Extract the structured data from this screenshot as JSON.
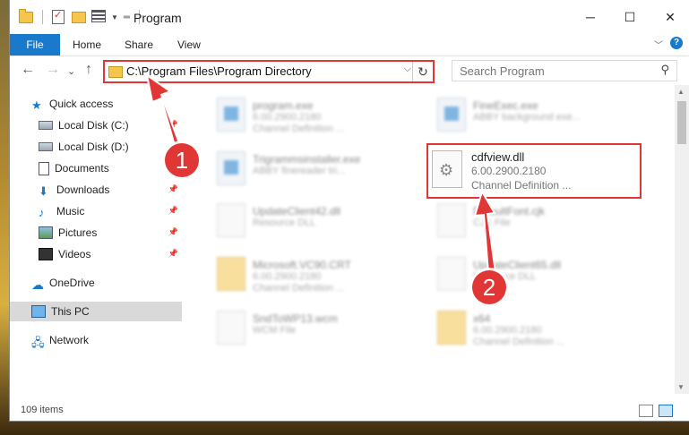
{
  "window": {
    "title": "Program",
    "controls": {
      "minimize": "─",
      "maximize": "☐",
      "close": "✕"
    }
  },
  "ribbon": {
    "tabs": [
      {
        "label": "File",
        "active": true
      },
      {
        "label": "Home"
      },
      {
        "label": "Share"
      },
      {
        "label": "View"
      }
    ],
    "help": "?"
  },
  "nav": {
    "back": "←",
    "forward": "→",
    "recent": "⌄",
    "up": "↑",
    "address": "C:\\Program Files\\Program Directory",
    "search_placeholder": "Search Program"
  },
  "sidebar": {
    "items": [
      {
        "label": "Quick access",
        "icon": "star-icon"
      },
      {
        "label": "Local Disk (C:)",
        "icon": "disk-icon",
        "pinned": true
      },
      {
        "label": "Local Disk (D:)",
        "icon": "disk-icon",
        "pinned": false
      },
      {
        "label": "Documents",
        "icon": "documents-icon",
        "pinned": true
      },
      {
        "label": "Downloads",
        "icon": "download-icon",
        "pinned": true
      },
      {
        "label": "Music",
        "icon": "music-icon",
        "pinned": true
      },
      {
        "label": "Pictures",
        "icon": "pictures-icon",
        "pinned": true
      },
      {
        "label": "Videos",
        "icon": "videos-icon",
        "pinned": true
      },
      {
        "label": "OneDrive",
        "icon": "cloud-icon"
      },
      {
        "label": "This PC",
        "icon": "computer-icon",
        "selected": true
      },
      {
        "label": "Network",
        "icon": "network-icon"
      }
    ]
  },
  "files": [
    {
      "name": "program.exe",
      "line2": "6.00.2900.2180",
      "line3": "Channel Definition ...",
      "icon": "exe"
    },
    {
      "name": "FineExec.exe",
      "line2": "ABBY background exe...",
      "line3": "",
      "icon": "exe"
    },
    {
      "name": "Trigrammsinstaller.exe",
      "line2": "ABBY finereader tri...",
      "line3": "",
      "icon": "exe"
    },
    {
      "name": "UpdateClient42.dll",
      "line2": "Resource DLL",
      "line3": "",
      "icon": "dll"
    },
    {
      "name": "DefaultFont.cjk",
      "line2": "CJK File",
      "line3": "",
      "icon": "dll"
    },
    {
      "name": "Microsoft.VC90.CRT",
      "line2": "6.00.2900.2180",
      "line3": "Channel Definition ...",
      "icon": "folder"
    },
    {
      "name": "UpdateClient65.dll",
      "line2": "Resource DLL",
      "line3": "",
      "icon": "dll"
    },
    {
      "name": "SndToWP13.wcm",
      "line2": "WCM File",
      "line3": "",
      "icon": "dll"
    },
    {
      "name": "x64",
      "line2": "6.00.2900.2180",
      "line3": "Channel Definition ...",
      "icon": "folder"
    }
  ],
  "highlighted_file": {
    "name": "cdfview.dll",
    "version": "6.00.2900.2180",
    "description": "Channel Definition ..."
  },
  "status": {
    "count": "109 items"
  },
  "annotations": {
    "step1": "1",
    "step2": "2",
    "color": "#e03636"
  }
}
